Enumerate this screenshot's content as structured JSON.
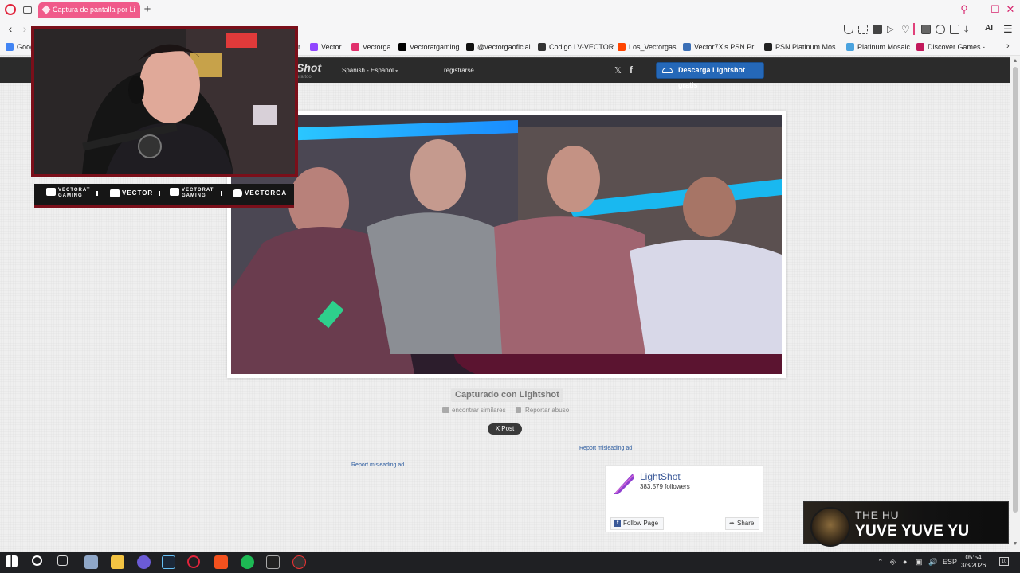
{
  "browser": {
    "active_tab_title": "Captura de pantalla por Li",
    "new_tab_symbol": "+",
    "url_fragment": "",
    "ai_label": "AI"
  },
  "bookmarks": [
    {
      "label": "Goog",
      "color": "#4285f4"
    },
    {
      "label": "r",
      "color": "#888888"
    },
    {
      "label": "Vector",
      "color": "#9146ff"
    },
    {
      "label": "Vectorga",
      "color": "#e1306c"
    },
    {
      "label": "Vectoratgaming",
      "color": "#000000"
    },
    {
      "label": "@vectorgaoficial",
      "color": "#111111"
    },
    {
      "label": "Codigo LV-VECTOR",
      "color": "#333333"
    },
    {
      "label": "Los_Vectorgas",
      "color": "#ff4500"
    },
    {
      "label": "Vector7X's PSN Pr...",
      "color": "#3b6fb6"
    },
    {
      "label": "PSN Platinum Mos...",
      "color": "#222222"
    },
    {
      "label": "Platinum Mosaic",
      "color": "#4aa3df"
    },
    {
      "label": "Discover Games -...",
      "color": "#c2185b"
    }
  ],
  "lightshot": {
    "logo_text": "Shot",
    "tagline": "ura tool",
    "language": "Spanish - Español",
    "register": "registrarse",
    "download_button": "Descarga Lightshot gratis",
    "captured_label": "Capturado con Lightshot",
    "find_similar": "encontrar similares",
    "report_abuse": "Reportar abuso",
    "x_post": "X Post",
    "report_ad_1": "Report misleading ad",
    "report_ad_2": "Report misleading ad"
  },
  "facebook_widget": {
    "page_name": "LightShot",
    "followers": "383,579 followers",
    "follow_button": "Follow Page",
    "share_button": "Share"
  },
  "stream_overlay": {
    "socials": [
      {
        "icon": "youtube-icon",
        "line1": "VECTORAT",
        "line2": "GAMING"
      },
      {
        "icon": "twitch-icon",
        "line1": "VECTOR",
        "line2": ""
      },
      {
        "icon": "twitter-icon",
        "line1": "VECTORAT",
        "line2": "GAMING"
      },
      {
        "icon": "instagram-icon",
        "line1": "VECTORGA",
        "line2": ""
      }
    ],
    "now_playing": {
      "artist": "THE HU",
      "track": "YUVE YUVE YU"
    }
  },
  "taskbar": {
    "language": "ESP",
    "time": "05:54",
    "date": "3/3/2026",
    "notification_count": "10"
  },
  "colors": {
    "accent": "#f05a8a",
    "lightshot_button": "#2568b8",
    "overlay_border": "#7a0f1a"
  }
}
